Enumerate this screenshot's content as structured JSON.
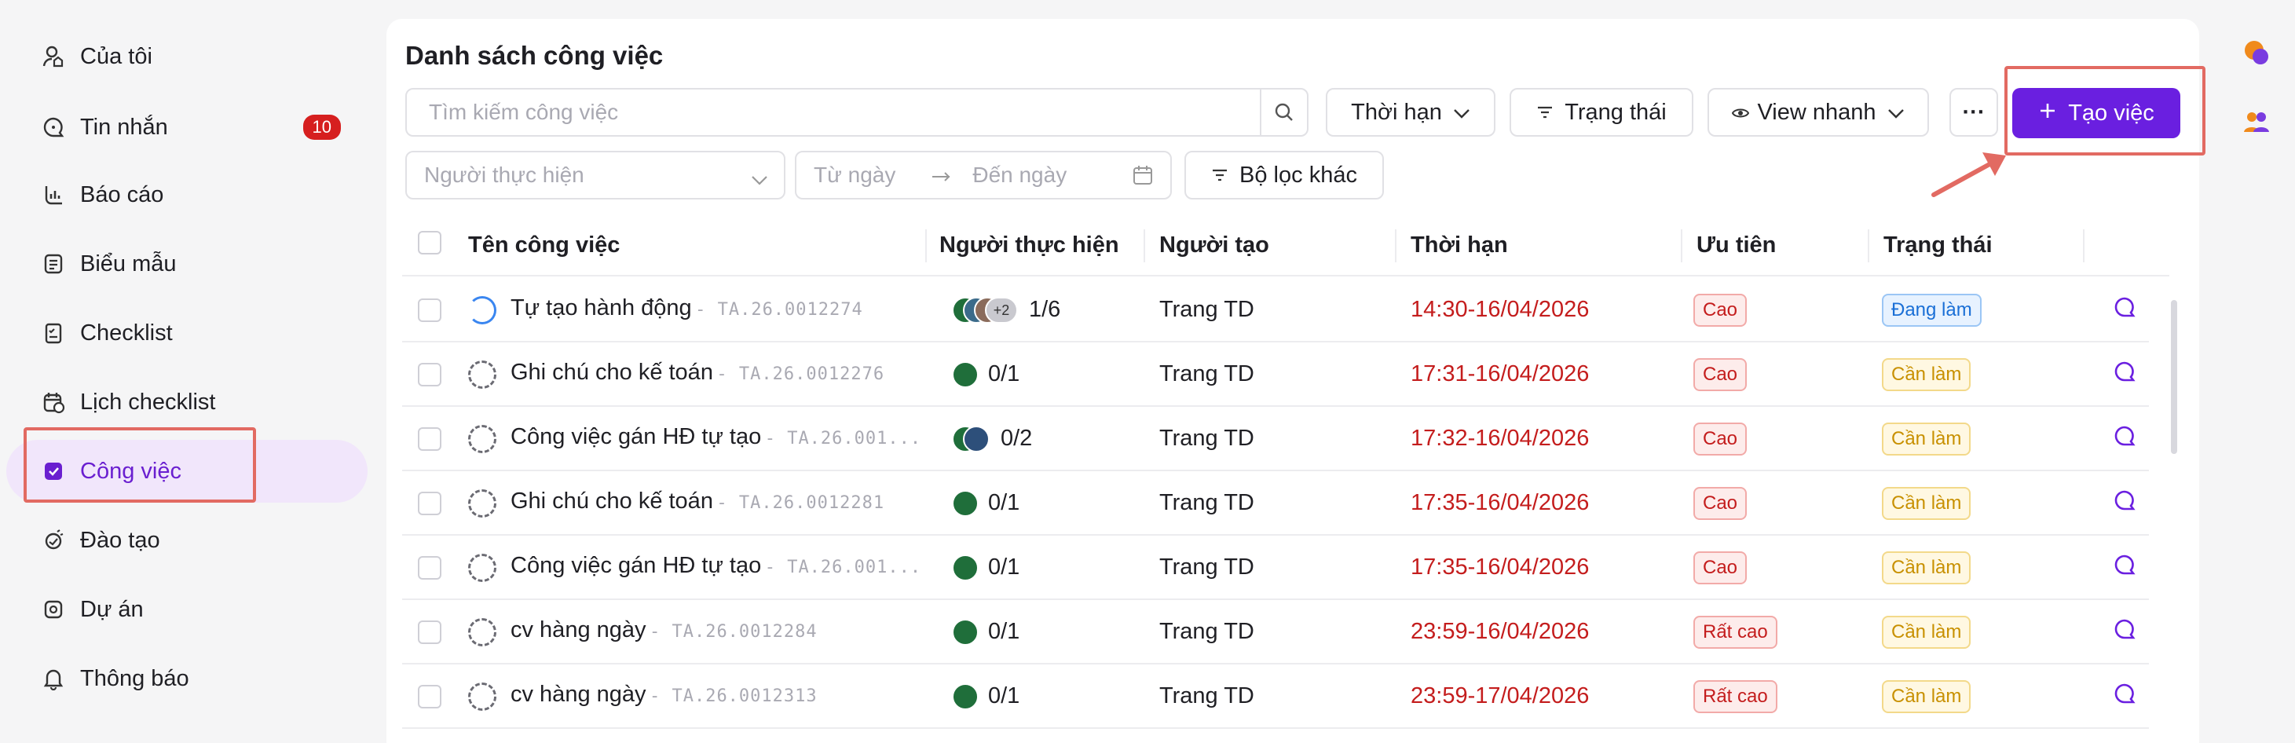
{
  "sidebar": {
    "items": [
      {
        "label": "Của tôi",
        "icon": "user-home-icon"
      },
      {
        "label": "Tin nhắn",
        "icon": "chat-icon",
        "badge": "10"
      },
      {
        "label": "Báo cáo",
        "icon": "report-icon"
      },
      {
        "label": "Biểu mẫu",
        "icon": "form-icon"
      },
      {
        "label": "Checklist",
        "icon": "checklist-icon"
      },
      {
        "label": "Lịch checklist",
        "icon": "calendar-check-icon"
      },
      {
        "label": "Công việc",
        "icon": "task-icon",
        "active": true
      },
      {
        "label": "Đào tạo",
        "icon": "training-icon"
      },
      {
        "label": "Dự án",
        "icon": "project-icon"
      },
      {
        "label": "Thông báo",
        "icon": "bell-icon"
      }
    ]
  },
  "page": {
    "title": "Danh sách công việc",
    "search_placeholder": "Tìm kiếm công việc",
    "deadline_filter": "Thời hạn",
    "status_filter": "Trạng thái",
    "quick_view": "View nhanh",
    "more": "···",
    "create_button": "Tạo việc",
    "assignee_placeholder": "Người thực hiện",
    "date_from_placeholder": "Từ ngày",
    "date_to_placeholder": "Đến ngày",
    "other_filters": "Bộ lọc khác"
  },
  "table": {
    "headers": {
      "name": "Tên công việc",
      "assignee": "Người thực hiện",
      "creator": "Người tạo",
      "deadline": "Thời hạn",
      "priority": "Ưu tiên",
      "status": "Trạng thái"
    },
    "rows": [
      {
        "name": "Tự tạo hành động",
        "code": "- TA.26.0012274",
        "progress": "1/6",
        "extra_avatars": "+2",
        "creator": "Trang TD",
        "deadline": "14:30-16/04/2026",
        "priority": "Cao",
        "status": "Đang làm",
        "status_kind": "doing"
      },
      {
        "name": "Ghi chú cho kế toán",
        "code": "- TA.26.0012276",
        "progress": "0/1",
        "creator": "Trang TD",
        "deadline": "17:31-16/04/2026",
        "priority": "Cao",
        "status": "Cần làm",
        "status_kind": "todo"
      },
      {
        "name": "Công việc gán HĐ tự tạo",
        "code": "- TA.26.001...",
        "progress": "0/2",
        "creator": "Trang TD",
        "deadline": "17:32-16/04/2026",
        "priority": "Cao",
        "status": "Cần làm",
        "status_kind": "todo"
      },
      {
        "name": "Ghi chú cho kế toán",
        "code": "- TA.26.0012281",
        "progress": "0/1",
        "creator": "Trang TD",
        "deadline": "17:35-16/04/2026",
        "priority": "Cao",
        "status": "Cần làm",
        "status_kind": "todo"
      },
      {
        "name": "Công việc gán HĐ tự tạo",
        "code": "- TA.26.001...",
        "progress": "0/1",
        "creator": "Trang TD",
        "deadline": "17:35-16/04/2026",
        "priority": "Cao",
        "status": "Cần làm",
        "status_kind": "todo"
      },
      {
        "name": "cv hàng ngày",
        "code": "- TA.26.0012284",
        "progress": "0/1",
        "creator": "Trang TD",
        "deadline": "23:59-16/04/2026",
        "priority": "Rất cao",
        "status": "Cần làm",
        "status_kind": "todo"
      },
      {
        "name": "cv hàng ngày",
        "code": "- TA.26.0012313",
        "progress": "0/1",
        "creator": "Trang TD",
        "deadline": "23:59-17/04/2026",
        "priority": "Rất cao",
        "status": "Cần làm",
        "status_kind": "todo"
      }
    ]
  },
  "colors": {
    "accent": "#6a1fe0",
    "deadline": "#c41d1d",
    "highlight": "#e26a62"
  }
}
